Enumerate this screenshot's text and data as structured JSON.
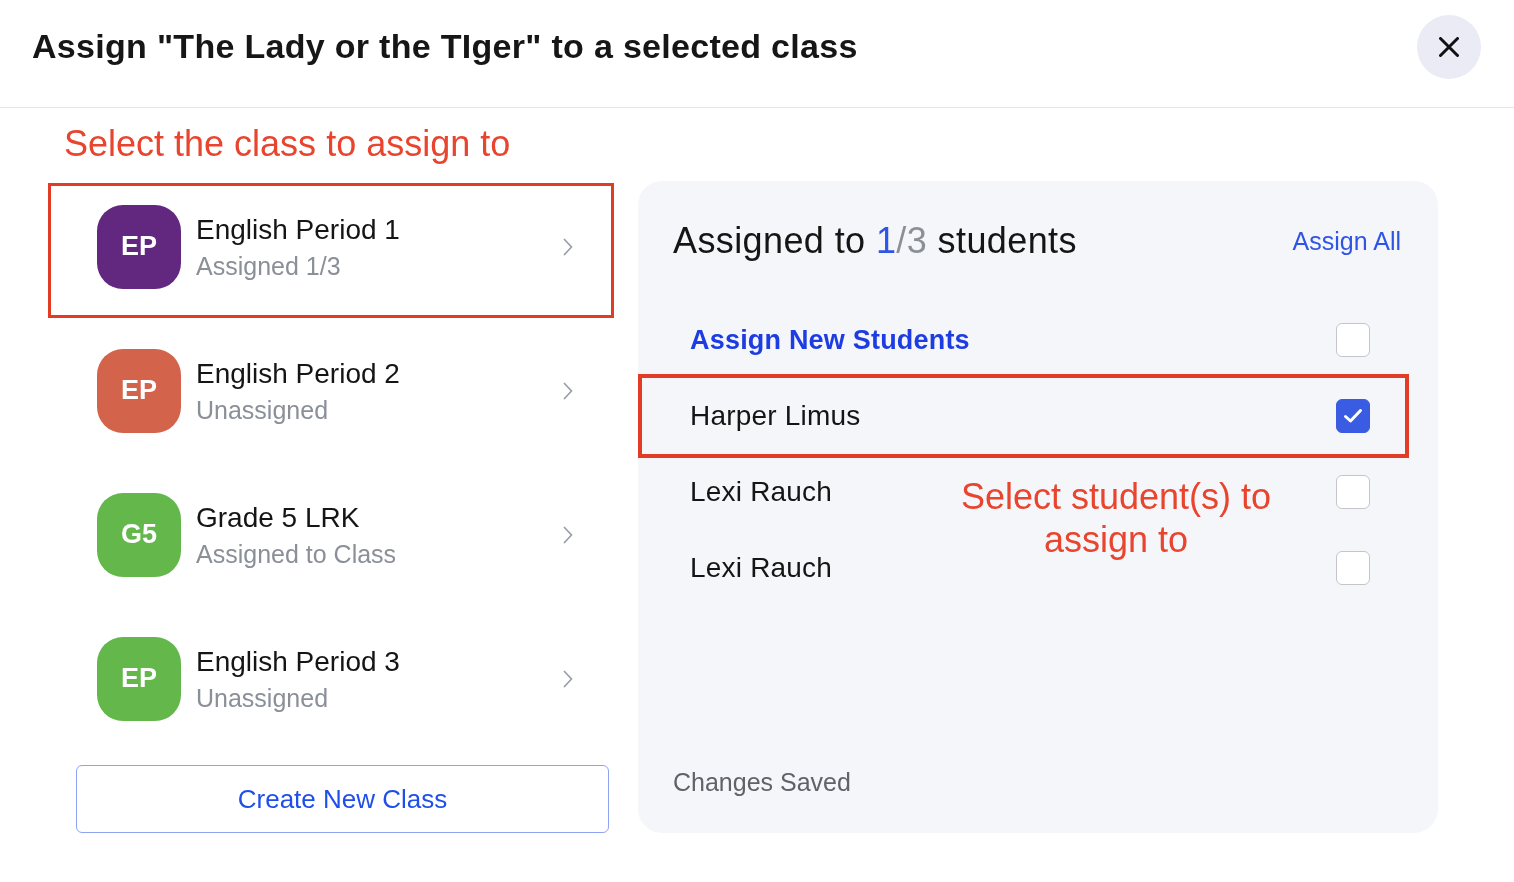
{
  "dialog": {
    "title": "Assign \"The Lady or the TIger\" to a selected class"
  },
  "class_panel": {
    "annotation": "Select the class to assign to",
    "classes": [
      {
        "initials": "EP",
        "name": "English Period 1",
        "status": "Assigned 1/3",
        "color": "#62277f",
        "highlighted": true
      },
      {
        "initials": "EP",
        "name": "English Period 2",
        "status": "Unassigned",
        "color": "#d4634c",
        "highlighted": false
      },
      {
        "initials": "G5",
        "name": "Grade 5 LRK",
        "status": "Assigned to Class",
        "color": "#63b74b",
        "highlighted": false
      },
      {
        "initials": "EP",
        "name": "English Period 3",
        "status": "Unassigned",
        "color": "#63b74b",
        "highlighted": false
      }
    ],
    "create_button": "Create New Class"
  },
  "student_panel": {
    "heading": {
      "prefix": "Assigned to",
      "assigned": "1",
      "of_total": "/3",
      "suffix": "students"
    },
    "assign_all": "Assign All",
    "rows": [
      {
        "kind": "option",
        "name": "Assign New Students",
        "checked": false,
        "highlighted": false
      },
      {
        "kind": "student",
        "name": "Harper Limus",
        "checked": true,
        "highlighted": true
      },
      {
        "kind": "student",
        "name": "Lexi Rauch",
        "checked": false,
        "highlighted": false
      },
      {
        "kind": "student",
        "name": "Lexi Rauch",
        "checked": false,
        "highlighted": false
      }
    ],
    "annotation": "Select student(s) to assign to",
    "status": "Changes Saved"
  }
}
